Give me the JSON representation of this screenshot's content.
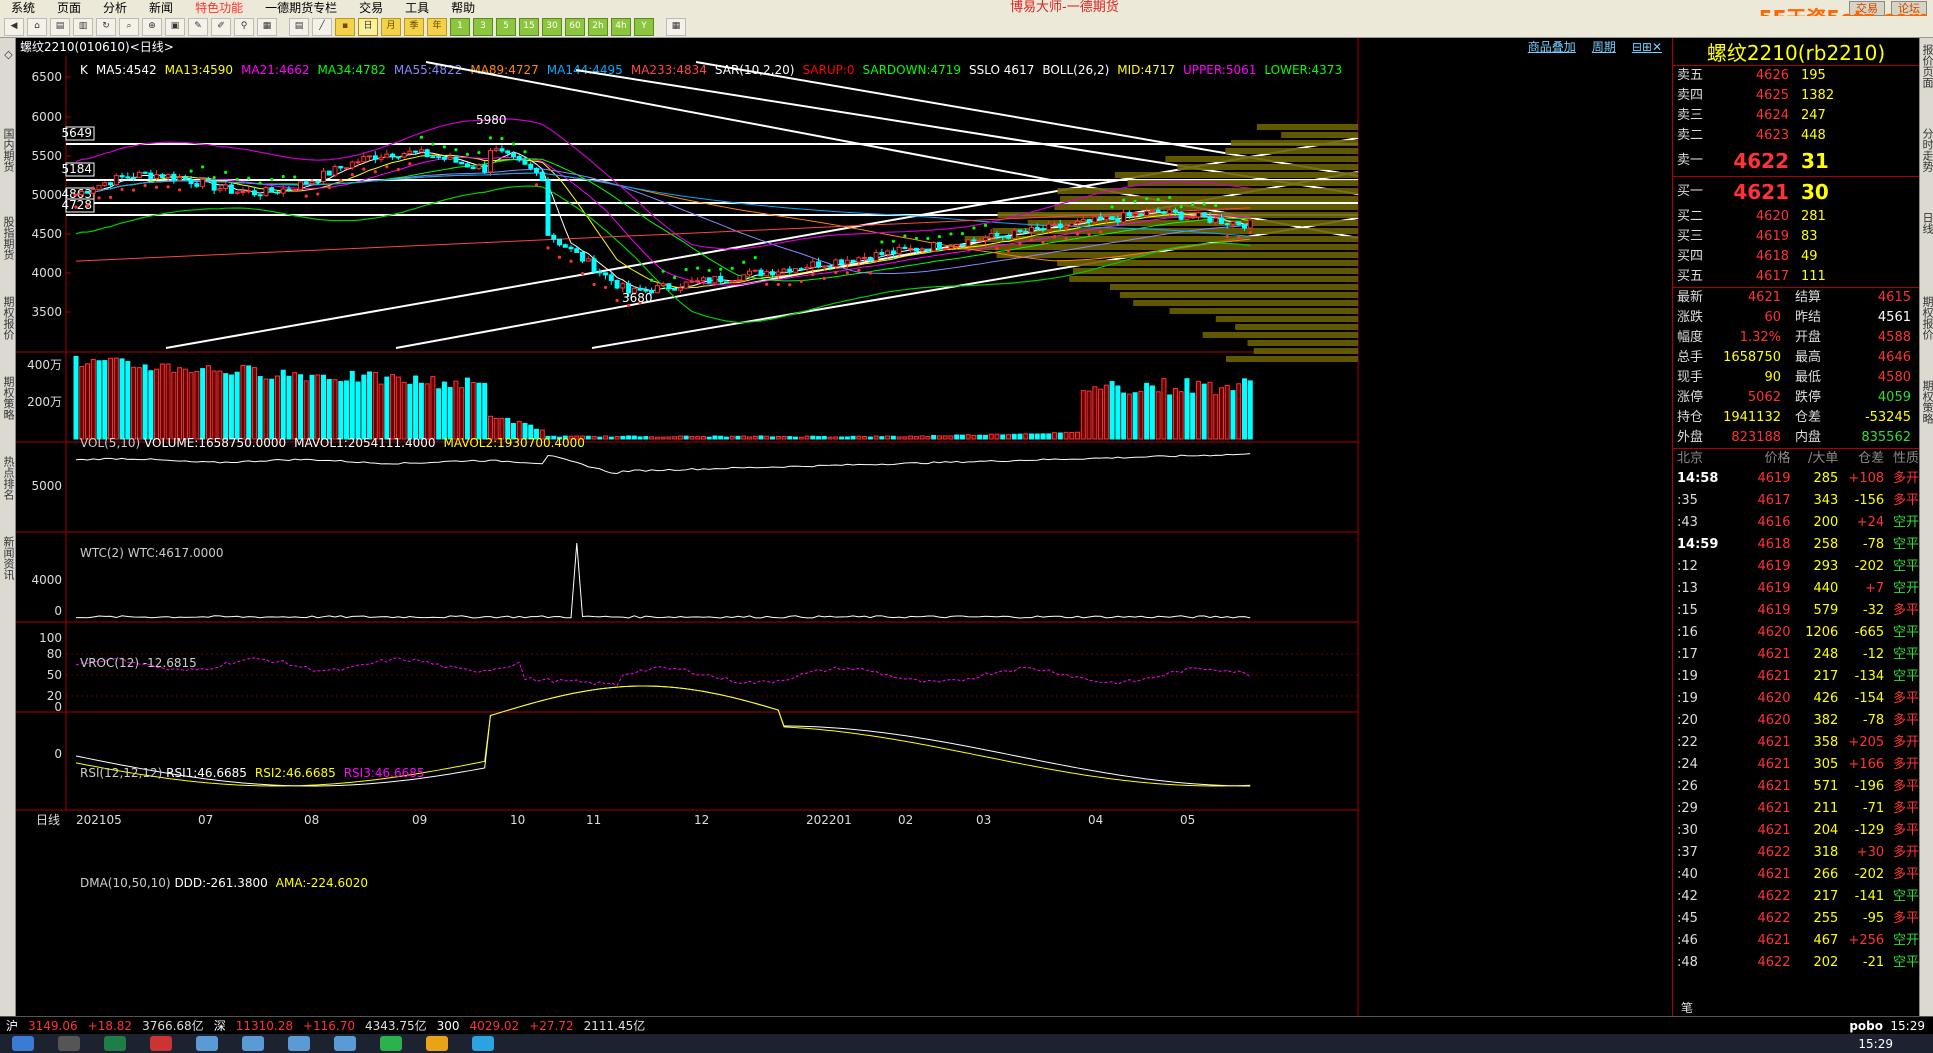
{
  "menu": {
    "items": [
      "系统",
      "页面",
      "分析",
      "新闻",
      "特色功能",
      "一德期货专栏",
      "交易",
      "工具",
      "帮助"
    ],
    "title": "博易大师-一德期货",
    "trade_btn": "交易",
    "chat_btn": "论坛",
    "watermark": "5E天资5etz.com"
  },
  "chart": {
    "symbol": "螺纹2210(010610)<日线>",
    "links": [
      "商品叠加",
      "周期"
    ],
    "main_indicators": [
      {
        "t": "K",
        "c": "#ffffff"
      },
      {
        "t": "MA5:4542",
        "c": "#ffffff"
      },
      {
        "t": "MA13:4590",
        "c": "#ffff00"
      },
      {
        "t": "MA21:4662",
        "c": "#ff00ff"
      },
      {
        "t": "MA34:4782",
        "c": "#00ff00"
      },
      {
        "t": "MA55:4822",
        "c": "#8888ff"
      },
      {
        "t": "MA89:4727",
        "c": "#ff8800"
      },
      {
        "t": "MA144:4495",
        "c": "#00aaff"
      },
      {
        "t": "MA233:4834",
        "c": "#ff4444"
      },
      {
        "t": "SAR(10,2,20)",
        "c": "#ffffff"
      },
      {
        "t": "SARUP:0",
        "c": "#ff0000"
      },
      {
        "t": "SARDOWN:4719",
        "c": "#00ff00"
      },
      {
        "t": "SSLO 4617",
        "c": "#ffffff"
      },
      {
        "t": "BOLL(26,2)",
        "c": "#ffffff"
      },
      {
        "t": "MID:4717",
        "c": "#ffff00"
      },
      {
        "t": "UPPER:5061",
        "c": "#ff00ff"
      },
      {
        "t": "LOWER:4373",
        "c": "#00ff00"
      }
    ],
    "price_axis": [
      "6500",
      "6000",
      "5500",
      "5000",
      "4500",
      "4000",
      "3500"
    ],
    "boxed_labels": [
      "5649",
      "5184",
      "4863",
      "4728"
    ],
    "peak_label": "5980",
    "low_label": "3680",
    "vol": {
      "label": "VOL(5,10)",
      "values": [
        {
          "t": "VOLUME:1658750.0000",
          "c": "#ffffff"
        },
        {
          "t": "MAVOL1:2054111.4000",
          "c": "#ffffff"
        },
        {
          "t": "MAVOL2:1930700.4000",
          "c": "#ffff00"
        }
      ],
      "axis": [
        "400万",
        "200万"
      ]
    },
    "wtc": {
      "label": "WTC(2)",
      "value": "WTC:4617.0000",
      "axis": [
        "5000"
      ]
    },
    "vroc": {
      "label": "VROC(12)",
      "value": "-12.6815",
      "axis": [
        "4000",
        "0"
      ]
    },
    "rsi": {
      "label": "RSI(12,12,12)",
      "values": [
        {
          "t": "RSI1:46.6685",
          "c": "#ffffff"
        },
        {
          "t": "RSI2:46.6685",
          "c": "#ffff00"
        },
        {
          "t": "RSI3:46.6685",
          "c": "#ff00ff"
        }
      ],
      "axis": [
        "100",
        "80",
        "50",
        "20",
        "0"
      ]
    },
    "dma": {
      "label": "DMA(10,50,10)",
      "values": [
        {
          "t": "DDD:-261.3800",
          "c": "#ffffff"
        },
        {
          "t": "AMA:-224.6020",
          "c": "#ffff00"
        }
      ],
      "axis": [
        "0"
      ]
    },
    "date_axis": [
      "日线",
      "202105",
      "07",
      "08",
      "09",
      "10",
      "11",
      "12",
      "202201",
      "02",
      "03",
      "04",
      "05"
    ]
  },
  "quote": {
    "title": "螺纹2210(rb2210)",
    "asks": [
      {
        "k": "卖五",
        "p": "4626",
        "v": "195"
      },
      {
        "k": "卖四",
        "p": "4625",
        "v": "1382"
      },
      {
        "k": "卖三",
        "p": "4624",
        "v": "247"
      },
      {
        "k": "卖二",
        "p": "4623",
        "v": "448"
      }
    ],
    "ask1": {
      "k": "卖一",
      "p": "4622",
      "v": "31"
    },
    "bid1": {
      "k": "买一",
      "p": "4621",
      "v": "30"
    },
    "bids": [
      {
        "k": "买二",
        "p": "4620",
        "v": "281"
      },
      {
        "k": "买三",
        "p": "4619",
        "v": "83"
      },
      {
        "k": "买四",
        "p": "4618",
        "v": "49"
      },
      {
        "k": "买五",
        "p": "4617",
        "v": "111"
      }
    ],
    "stats": [
      {
        "a": "最新",
        "b": "4621",
        "bc": "red",
        "c": "结算",
        "d": "4615",
        "dc": "red"
      },
      {
        "a": "涨跌",
        "b": "60",
        "bc": "red",
        "c": "昨结",
        "d": "4561",
        "dc": "wht"
      },
      {
        "a": "幅度",
        "b": "1.32%",
        "bc": "red",
        "c": "开盘",
        "d": "4588",
        "dc": "red"
      },
      {
        "a": "总手",
        "b": "1658750",
        "bc": "yel",
        "c": "最高",
        "d": "4646",
        "dc": "red"
      },
      {
        "a": "现手",
        "b": "90",
        "bc": "yel",
        "c": "最低",
        "d": "4580",
        "dc": "red"
      },
      {
        "a": "涨停",
        "b": "5062",
        "bc": "red",
        "c": "跌停",
        "d": "4059",
        "dc": "grn"
      },
      {
        "a": "持仓",
        "b": "1941132",
        "bc": "yel",
        "c": "仓差",
        "d": "-53245",
        "dc": "yel"
      },
      {
        "a": "外盘",
        "b": "823188",
        "bc": "red",
        "c": "内盘",
        "d": "835562",
        "dc": "grn"
      }
    ],
    "ticks_header": [
      "北京",
      "价格",
      "/大单",
      "仓差",
      "性质"
    ],
    "ticks": [
      {
        "t": "14:58",
        "p": "4619",
        "v": "285",
        "o": "+108",
        "y": "多开"
      },
      {
        "t": ":35",
        "p": "4617",
        "v": "343",
        "o": "-156",
        "y": "多平"
      },
      {
        "t": ":43",
        "p": "4616",
        "v": "200",
        "o": "+24",
        "y": "空开"
      },
      {
        "t": "14:59",
        "p": "4618",
        "v": "258",
        "o": "-78",
        "y": "空平"
      },
      {
        "t": ":12",
        "p": "4619",
        "v": "293",
        "o": "-202",
        "y": "空平"
      },
      {
        "t": ":13",
        "p": "4619",
        "v": "440",
        "o": "+7",
        "y": "空开"
      },
      {
        "t": ":15",
        "p": "4619",
        "v": "579",
        "o": "-32",
        "y": "多平"
      },
      {
        "t": ":16",
        "p": "4620",
        "v": "1206",
        "o": "-665",
        "y": "空平"
      },
      {
        "t": ":17",
        "p": "4621",
        "v": "248",
        "o": "-12",
        "y": "空平"
      },
      {
        "t": ":19",
        "p": "4621",
        "v": "217",
        "o": "-134",
        "y": "空平"
      },
      {
        "t": ":19",
        "p": "4620",
        "v": "426",
        "o": "-154",
        "y": "多平"
      },
      {
        "t": ":20",
        "p": "4620",
        "v": "382",
        "o": "-78",
        "y": "多平"
      },
      {
        "t": ":22",
        "p": "4621",
        "v": "358",
        "o": "+205",
        "y": "多开"
      },
      {
        "t": ":24",
        "p": "4621",
        "v": "305",
        "o": "+166",
        "y": "多开"
      },
      {
        "t": ":26",
        "p": "4621",
        "v": "571",
        "o": "-196",
        "y": "多平"
      },
      {
        "t": ":29",
        "p": "4621",
        "v": "211",
        "o": "-71",
        "y": "多平"
      },
      {
        "t": ":30",
        "p": "4621",
        "v": "204",
        "o": "-129",
        "y": "多平"
      },
      {
        "t": ":37",
        "p": "4622",
        "v": "318",
        "o": "+30",
        "y": "多开"
      },
      {
        "t": ":40",
        "p": "4621",
        "v": "266",
        "o": "-202",
        "y": "多平"
      },
      {
        "t": ":42",
        "p": "4622",
        "v": "217",
        "o": "-141",
        "y": "空平"
      },
      {
        "t": ":45",
        "p": "4622",
        "v": "255",
        "o": "-95",
        "y": "多平"
      },
      {
        "t": ":46",
        "p": "4621",
        "v": "467",
        "o": "+256",
        "y": "空开"
      },
      {
        "t": ":48",
        "p": "4622",
        "v": "202",
        "o": "-21",
        "y": "空平"
      }
    ],
    "footer": "笔"
  },
  "left_tabs": [
    "国内期货",
    "股指期货",
    "期权报价",
    "期权策略",
    "热点排名",
    "新闻资讯"
  ],
  "right_tabs": [
    "报价页面",
    "分时走势",
    "日线",
    "期权报价",
    "期权策略"
  ],
  "status": {
    "items": [
      {
        "t": "沪",
        "c": "#fff"
      },
      {
        "t": "3149.06",
        "c": "#f33"
      },
      {
        "t": "+18.82",
        "c": "#f33"
      },
      {
        "t": "3766.68亿",
        "c": "#ddd"
      },
      {
        "t": "深",
        "c": "#fff"
      },
      {
        "t": "11310.28",
        "c": "#f33"
      },
      {
        "t": "+116.70",
        "c": "#f33"
      },
      {
        "t": "4343.75亿",
        "c": "#ddd"
      },
      {
        "t": "300",
        "c": "#fff"
      },
      {
        "t": "4029.02",
        "c": "#f33"
      },
      {
        "t": "+27.72",
        "c": "#f33"
      },
      {
        "t": "2111.45亿",
        "c": "#ddd"
      }
    ],
    "brand": "pobo",
    "time": "15:29"
  },
  "taskbar": {
    "time": "15:29"
  }
}
